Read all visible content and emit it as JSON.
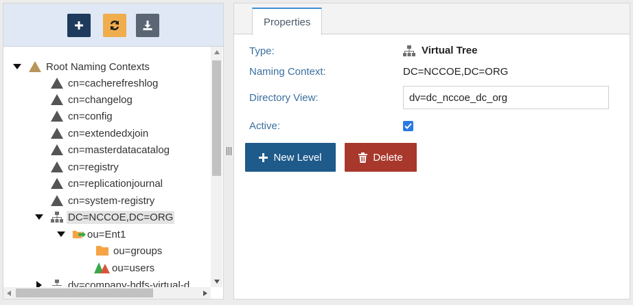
{
  "toolbar": {
    "add_icon": "plus-icon",
    "refresh_icon": "refresh-icon",
    "download_icon": "download-icon",
    "colors": {
      "add": "#1e3a5c",
      "refresh": "#f0ad4e",
      "download": "#5b6675"
    }
  },
  "tree": {
    "root": "Root Naming Contexts",
    "items": [
      {
        "label": "cn=cacherefreshlog",
        "icon": "triangle-icon"
      },
      {
        "label": "cn=changelog",
        "icon": "triangle-icon"
      },
      {
        "label": "cn=config",
        "icon": "triangle-icon"
      },
      {
        "label": "cn=extendedxjoin",
        "icon": "triangle-icon"
      },
      {
        "label": "cn=masterdatacatalog",
        "icon": "triangle-icon"
      },
      {
        "label": "cn=registry",
        "icon": "triangle-icon"
      },
      {
        "label": "cn=replicationjournal",
        "icon": "triangle-icon"
      },
      {
        "label": "cn=system-registry",
        "icon": "triangle-icon"
      },
      {
        "label": "DC=NCCOE,DC=ORG",
        "icon": "hierarchy-icon",
        "selected": true
      },
      {
        "label": "ou=Ent1",
        "icon": "folder-arrow-icon"
      },
      {
        "label": "ou=groups",
        "icon": "folder-icon"
      },
      {
        "label": "ou=users",
        "icon": "multi-triangle-icon"
      },
      {
        "label": "dv=company-hdfs-virtual-d",
        "icon": "hierarchy-icon"
      }
    ]
  },
  "properties": {
    "tab": "Properties",
    "type_label": "Type:",
    "type_value": "Virtual Tree",
    "type_icon": "hierarchy-icon",
    "naming_context_label": "Naming Context:",
    "naming_context_value": "DC=NCCOE,DC=ORG",
    "directory_view_label": "Directory View:",
    "directory_view_value": "dv=dc_nccoe_dc_org",
    "active_label": "Active:",
    "active_checked": true,
    "new_level_label": "New Level",
    "delete_label": "Delete",
    "colors": {
      "label": "#3a6fa0",
      "new_level": "#1e5a8a",
      "delete": "#a8382c",
      "tab_accent": "#3f8fd2"
    }
  }
}
